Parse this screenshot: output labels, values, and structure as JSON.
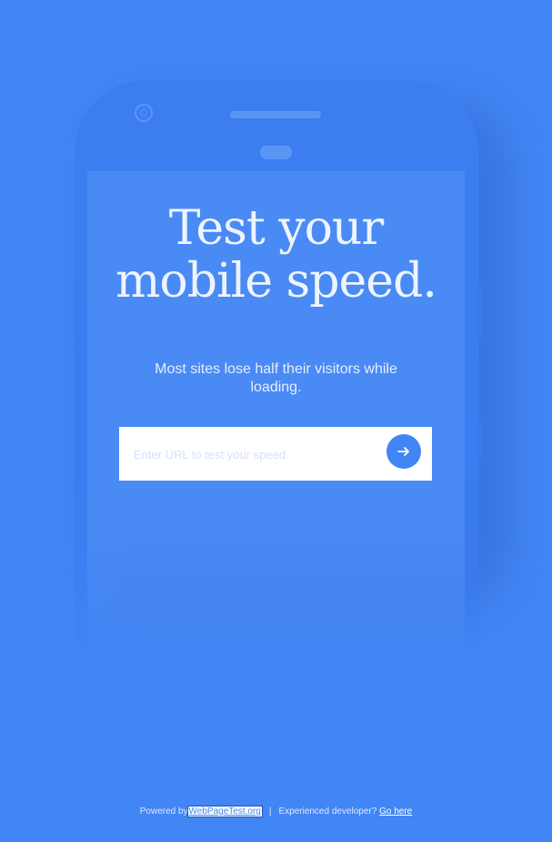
{
  "hero": {
    "headline_line1": "Test your",
    "headline_line2": "mobile speed.",
    "subtitle": "Most sites lose half their visitors while loading."
  },
  "url_form": {
    "placeholder": "Enter URL to test your speed",
    "submit_icon": "arrow-right-icon"
  },
  "footer": {
    "powered_by": "Powered by",
    "wpt_link": "WebPageTest.org",
    "separator": "|",
    "dev_text": "Experienced developer?",
    "dev_link": "Go here"
  },
  "colors": {
    "background": "#4285f4",
    "button": "#4285f4",
    "input_bg": "#ffffff"
  }
}
